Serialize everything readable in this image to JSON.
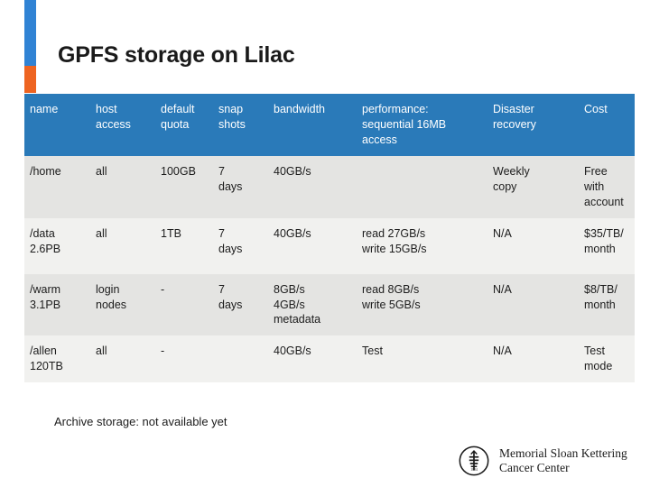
{
  "slide": {
    "title": "GPFS storage on Lilac",
    "footer_note": "Archive storage: not available yet"
  },
  "accent": {
    "top_color": "#3083d4",
    "bottom_color": "#ee6421"
  },
  "table": {
    "header_bg": "#2a7ab9",
    "row_bg_even": "#e4e4e2",
    "row_bg_odd": "#f1f1ef",
    "columns": [
      "name",
      "host access",
      "default quota",
      "snap shots",
      "bandwidth",
      "performance: sequential 16MB access",
      "Disaster recovery",
      "Cost"
    ],
    "rows": [
      {
        "name": "/home",
        "name_line2": "",
        "host_access": "all",
        "default_quota": "100GB",
        "snapshots_l1": "7",
        "snapshots_l2": "days",
        "bandwidth_l1": "40GB/s",
        "bandwidth_l2": "",
        "bandwidth_l3": "",
        "performance_l1": "",
        "performance_l2": "",
        "disaster_recovery_l1": "Weekly",
        "disaster_recovery_l2": "copy",
        "cost_l1": "Free",
        "cost_l2": "with",
        "cost_l3": "account"
      },
      {
        "name": "/data",
        "name_line2": "2.6PB",
        "host_access": "all",
        "default_quota": "1TB",
        "snapshots_l1": "7",
        "snapshots_l2": "days",
        "bandwidth_l1": "40GB/s",
        "bandwidth_l2": "",
        "bandwidth_l3": "",
        "performance_l1": "read 27GB/s",
        "performance_l2": "write 15GB/s",
        "disaster_recovery_l1": "N/A",
        "disaster_recovery_l2": "",
        "cost_l1": "$35/TB/",
        "cost_l2": "month",
        "cost_l3": ""
      },
      {
        "name": "/warm",
        "name_line2": "3.1PB",
        "host_access": "login nodes",
        "default_quota": "-",
        "snapshots_l1": "7",
        "snapshots_l2": "days",
        "bandwidth_l1": "8GB/s",
        "bandwidth_l2": "4GB/s",
        "bandwidth_l3": "metadata",
        "performance_l1": "read 8GB/s",
        "performance_l2": "write 5GB/s",
        "disaster_recovery_l1": "N/A",
        "disaster_recovery_l2": "",
        "cost_l1": "$8/TB/",
        "cost_l2": "month",
        "cost_l3": ""
      },
      {
        "name": "/allen",
        "name_line2": "120TB",
        "host_access": "all",
        "default_quota": "-",
        "snapshots_l1": "",
        "snapshots_l2": "",
        "bandwidth_l1": "40GB/s",
        "bandwidth_l2": "",
        "bandwidth_l3": "",
        "performance_l1": "Test",
        "performance_l2": "",
        "disaster_recovery_l1": "N/A",
        "disaster_recovery_l2": "",
        "cost_l1": "Test",
        "cost_l2": "mode",
        "cost_l3": ""
      }
    ]
  },
  "logo": {
    "emblem_name": "msk-caduceus-emblem",
    "line1": "Memorial Sloan Kettering",
    "line2": "Cancer Center"
  }
}
